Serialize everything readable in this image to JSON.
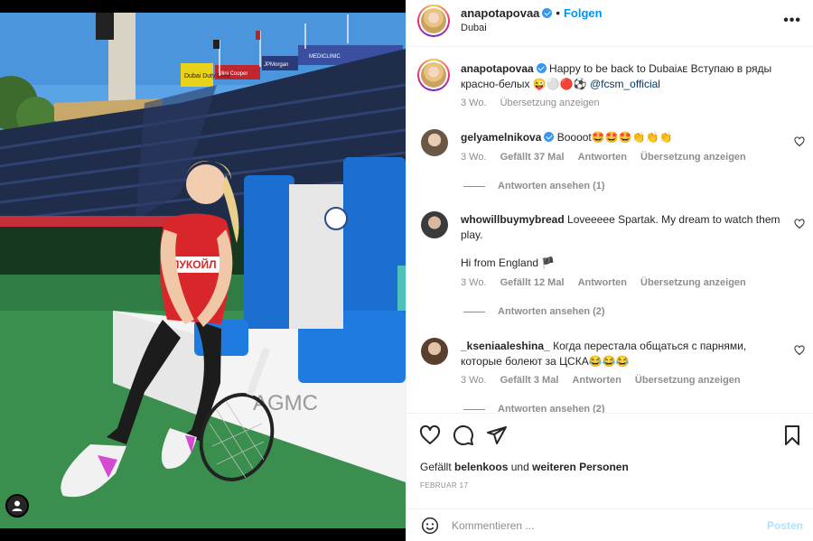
{
  "post_header": {
    "username": "anapotapovaa",
    "follow_label": "Folgen",
    "separator": "•",
    "location": "Dubai",
    "more_label": "•••"
  },
  "photo": {
    "banners": [
      "Dubai Duty Free",
      "Mini Cooper",
      "JPMorgan",
      "MEDICLINIC"
    ],
    "jersey_text": "ЛУКОЙЛ",
    "court_text": "AGMC",
    "user_tags_icon": "person-icon"
  },
  "caption": {
    "username": "anapotapovaa",
    "text": "Happy to be back to Dubaiᴀᴇ Вступаю в ряды красно-белых 😜⚪🔴⚽",
    "mention": "@fcsm_official",
    "time": "3 Wo.",
    "translate": "Übersetzung anzeigen"
  },
  "comments": [
    {
      "username": "gelyamelnikova",
      "verified": true,
      "text": "Boooot🤩🤩🤩👏👏👏",
      "time": "3 Wo.",
      "likes": "Gefällt 37 Mal",
      "reply": "Antworten",
      "translate": "Übersetzung anzeigen",
      "replies": "Antworten ansehen (1)"
    },
    {
      "username": "whowillbuymybread",
      "text": "Loveeeee Spartak. My dream to watch them play.",
      "text2": "Hi from England 🏴",
      "time": "3 Wo.",
      "likes": "Gefällt 12 Mal",
      "reply": "Antworten",
      "translate": "Übersetzung anzeigen",
      "replies": "Antworten ansehen (2)"
    },
    {
      "username": "_kseniaaleshina_",
      "text": "Когда перестала общаться с парнями, которые болеют за ЦСКА😂😂😂",
      "time": "3 Wo.",
      "likes": "Gefällt 3 Mal",
      "reply": "Antworten",
      "translate": "Übersetzung anzeigen",
      "replies": "Antworten ansehen (2)"
    }
  ],
  "actions": {
    "icons": [
      "heart-icon",
      "comment-icon",
      "share-icon",
      "bookmark-icon"
    ],
    "likes_prefix": "Gefällt",
    "likes_user": "belenkoos",
    "likes_mid": "und",
    "likes_others": "weiteren Personen",
    "date": "FEBRUAR 17"
  },
  "compose": {
    "placeholder": "Kommentieren ...",
    "post_label": "Posten"
  },
  "colors": {
    "accent": "#0095f6",
    "verified": "#3897f0",
    "muted": "#8e8e8e",
    "jersey_red": "#d9262b",
    "court_green": "#3a8f4e"
  }
}
